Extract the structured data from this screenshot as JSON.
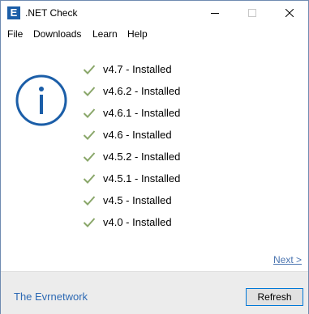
{
  "window": {
    "title": ".NET Check",
    "app_icon_letter": "E"
  },
  "menu": {
    "items": [
      "File",
      "Downloads",
      "Learn",
      "Help"
    ]
  },
  "versions": [
    "v4.7 - Installed",
    "v4.6.2 - Installed",
    "v4.6.1 - Installed",
    "v4.6 - Installed",
    "v4.5.2 - Installed",
    "v4.5.1 - Installed",
    "v4.5 - Installed",
    "v4.0 - Installed"
  ],
  "next_link": "Next >",
  "footer": {
    "link": "The Evrnetwork",
    "refresh_label": "Refresh"
  },
  "colors": {
    "accent": "#1b5ea8",
    "check": "#8aa76a",
    "link": "#2e6ab4"
  },
  "icons": {
    "app": "app-logo-icon",
    "info": "info-icon",
    "check": "check-icon"
  }
}
